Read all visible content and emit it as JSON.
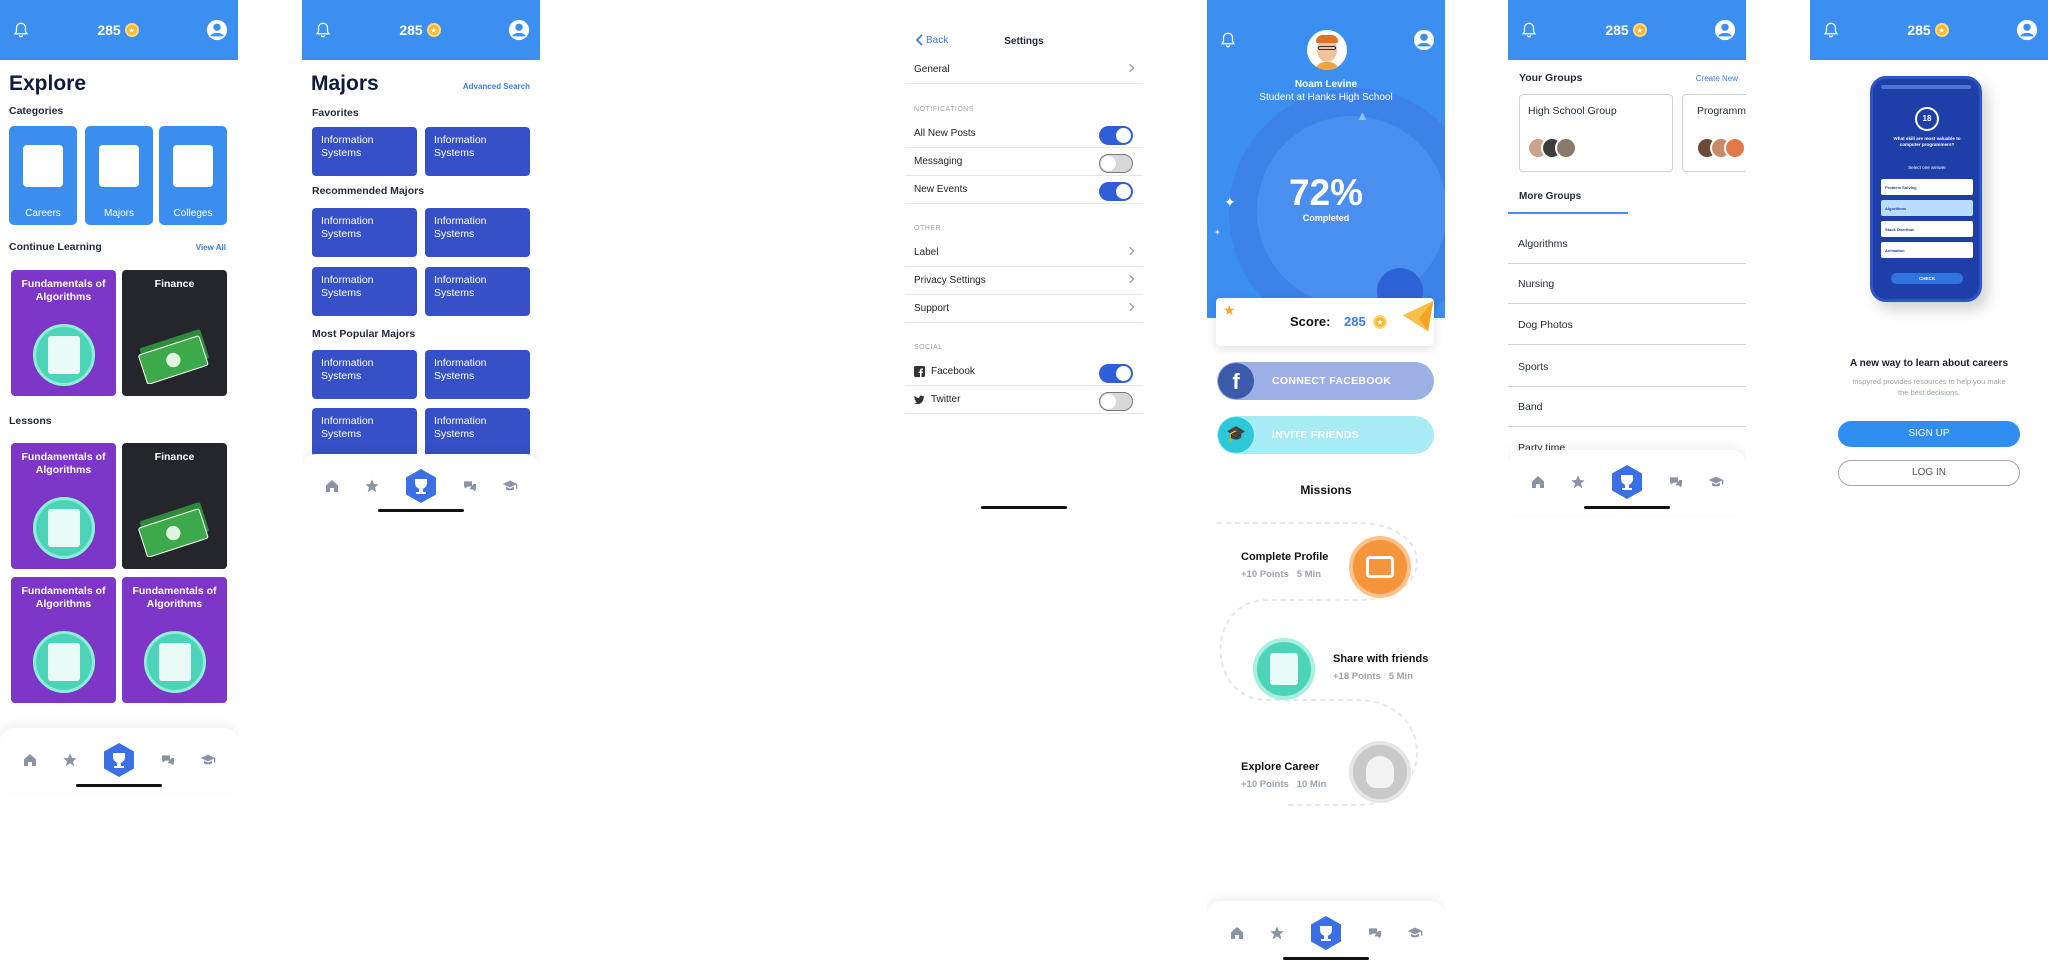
{
  "common": {
    "score": "285"
  },
  "explore": {
    "title": "Explore",
    "categories_heading": "Categories",
    "categories": [
      "Careers",
      "Majors",
      "Colleges"
    ],
    "continue_heading": "Continue Learning",
    "view_all": "View All",
    "continue_cards": [
      {
        "title": "Fundamentals of Algorithms"
      },
      {
        "title": "Finance"
      }
    ],
    "lessons_heading": "Lessons",
    "lessons": [
      {
        "title": "Fundamentals of Algorithms"
      },
      {
        "title": "Finance"
      },
      {
        "title": "Fundamentals of Algorithms"
      },
      {
        "title": "Fundamentals of Algorithms"
      }
    ]
  },
  "majors": {
    "title": "Majors",
    "advanced_search": "Advanced Search",
    "favorites_heading": "Favorites",
    "recommended_heading": "Recommended Majors",
    "popular_heading": "Most Popular Majors",
    "item_label": "Information Systems"
  },
  "settings": {
    "back": "Back",
    "title": "Settings",
    "general": "General",
    "notifications_heading": "NOTIFICATIONS",
    "all_new_posts": "All New Posts",
    "messaging": "Messaging",
    "new_events": "New Events",
    "other_heading": "OTHER",
    "label": "Label",
    "privacy": "Privacy Settings",
    "support": "Support",
    "social_heading": "SOCIAL",
    "facebook": "Facebook",
    "twitter": "Twitter",
    "toggles": {
      "all_new_posts": true,
      "messaging": false,
      "new_events": true,
      "facebook": true,
      "twitter": false
    }
  },
  "profile": {
    "name": "Noam Levine",
    "subtitle": "Student at Hanks High School",
    "progress_value": "72%",
    "progress_label": "Completed",
    "score_label": "Score:",
    "score_value": "285",
    "connect_facebook": "CONNECT FACEBOOK",
    "invite_friends": "INVITE FRIENDS",
    "missions_heading": "Missions",
    "missions": [
      {
        "title": "Complete Profile",
        "points": "+10 Points",
        "time": "5 Min"
      },
      {
        "title": "Share with friends",
        "points": "+18 Points",
        "time": "5 Min"
      },
      {
        "title": "Explore Career",
        "points": "+10 Points",
        "time": "10 Min"
      }
    ]
  },
  "groups": {
    "your_groups": "Your Groups",
    "create_new": "Create New",
    "group_cards": [
      "High School Group",
      "Programm"
    ],
    "more_groups": "More Groups",
    "list": [
      "Algorithms",
      "Nursing",
      "Dog Photos",
      "Sports",
      "Band",
      "Party time"
    ]
  },
  "onboarding": {
    "phone": {
      "timer": "18",
      "question": "What skill are most valuable to computer programmers?",
      "select": "Select one answer",
      "options": [
        "Problem Solving",
        "Algorithms",
        "Stack Overflow",
        "Animation"
      ],
      "check": "CHECK"
    },
    "heading": "A new way to learn about careers",
    "body": "Inspyred provides resources to help you make the best decisions.",
    "sign_up": "SIGN UP",
    "log_in": "LOG IN"
  },
  "colors": {
    "primary": "#3b8ff0",
    "purple": "#7e36c8",
    "navy": "#3650c8",
    "teal": "#4dd4b8",
    "orange": "#f5953b"
  }
}
